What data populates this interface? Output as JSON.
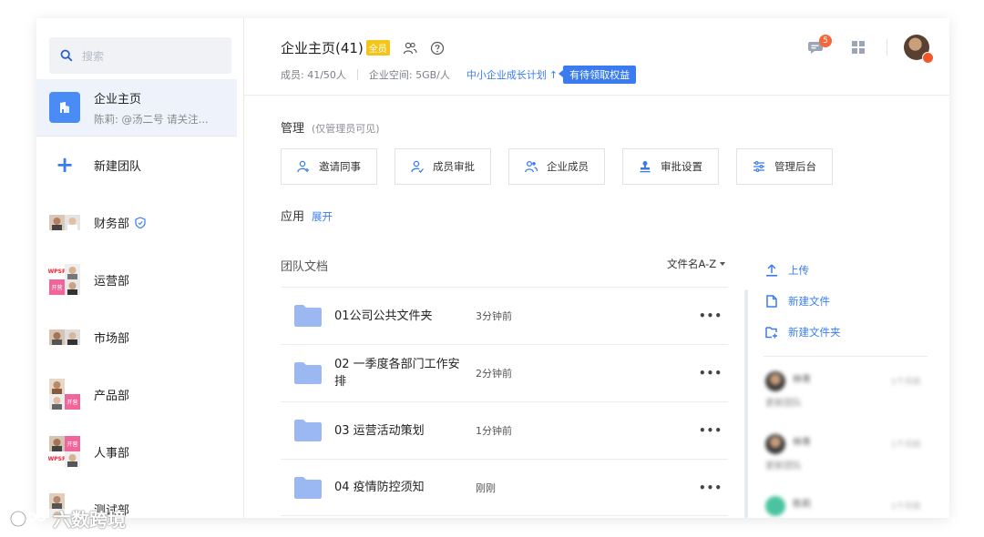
{
  "sidebar": {
    "search_placeholder": "搜索",
    "home": {
      "title": "企业主页",
      "subtitle": "陈莉: @汤二号 请关注..."
    },
    "new_team": "新建团队",
    "teams": [
      {
        "label": "财务部"
      },
      {
        "label": "运营部",
        "tag": "开营",
        "tag2": "WPSP"
      },
      {
        "label": "市场部"
      },
      {
        "label": "产品部",
        "tag": "开营"
      },
      {
        "label": "人事部",
        "tag": "开营",
        "tag2": "WPSP"
      },
      {
        "label": "测试部"
      }
    ]
  },
  "header": {
    "title": "企业主页(41)",
    "badge": "全员",
    "members": "成员: 41/50人",
    "space": "企业空间: 5GB/人",
    "plan_link": "中小企业成长计划",
    "plan_arrow": "↑",
    "pending": "有待领取权益",
    "chat_count": "5"
  },
  "admin": {
    "title": "管理",
    "note": "(仅管理员可见)",
    "actions": [
      "邀请同事",
      "成员审批",
      "企业成员",
      "审批设置",
      "管理后台"
    ]
  },
  "apps": {
    "title": "应用",
    "expand": "展开"
  },
  "docs": {
    "title": "团队文档",
    "sort": "文件名A-Z",
    "rows": [
      {
        "name": "01公司公共文件夹",
        "time": "3分钟前"
      },
      {
        "name": "02 一季度各部门工作安排",
        "time": "2分钟前"
      },
      {
        "name": "03 运营活动策划",
        "time": "1分钟前"
      },
      {
        "name": "04 疫情防控须知",
        "time": "刚刚"
      }
    ],
    "more": "•••"
  },
  "right_panel": {
    "upload": "上传",
    "new_file": "新建文件",
    "new_folder": "新建文件夹",
    "feed": [
      {
        "name": "林青",
        "sub": "更新团队",
        "time": "1个月前"
      },
      {
        "name": "林青",
        "sub": "更新团队",
        "time": "1个月前"
      },
      {
        "name": "陈莉",
        "sub": "",
        "time": "1个月前"
      }
    ]
  },
  "watermark": "六数跨境",
  "colors": {
    "accent": "#3a7cf0",
    "badge_yellow": "#f3c51a",
    "folder": "#9bb8f3",
    "notification": "#f5683a"
  }
}
